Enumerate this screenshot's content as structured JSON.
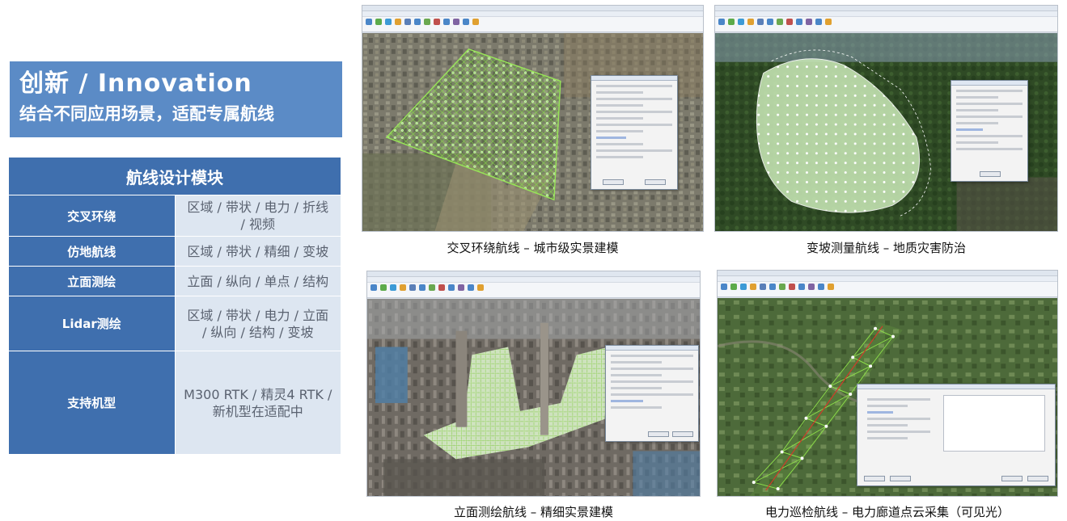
{
  "hero": {
    "title": "创新 / Innovation",
    "subtitle": "结合不同应用场景，适配专属航线"
  },
  "module": {
    "header": "航线设计模块",
    "rows": [
      {
        "label": "交叉环绕",
        "value": "区域 / 带状 / 电力 / 折线 / 视频"
      },
      {
        "label": "仿地航线",
        "value": "区域 / 带状 / 精细 / 变坡"
      },
      {
        "label": "立面测绘",
        "value": "立面 / 纵向 / 单点 / 结构"
      },
      {
        "label": "Lidar测绘",
        "value": "区域 / 带状 / 电力 / 立面 / 纵向 / 结构 / 变坡"
      },
      {
        "label": "支持机型",
        "value": "M300 RTK / 精灵4 RTK /新机型在适配中"
      }
    ]
  },
  "panels": [
    {
      "caption": "交叉环绕航线 – 城市级实景建模"
    },
    {
      "caption": "变坡测量航线 – 地质灾害防治"
    },
    {
      "caption": "立面测绘航线 – 精细实景建模"
    },
    {
      "caption": "电力巡检航线 – 电力廊道点云采集（可见光）"
    }
  ],
  "colors": {
    "hero_bg": "#5b8bc6",
    "table_header": "#3f6fae",
    "table_cell": "#dde6f1",
    "flight_line_green": "#7fd13b"
  }
}
